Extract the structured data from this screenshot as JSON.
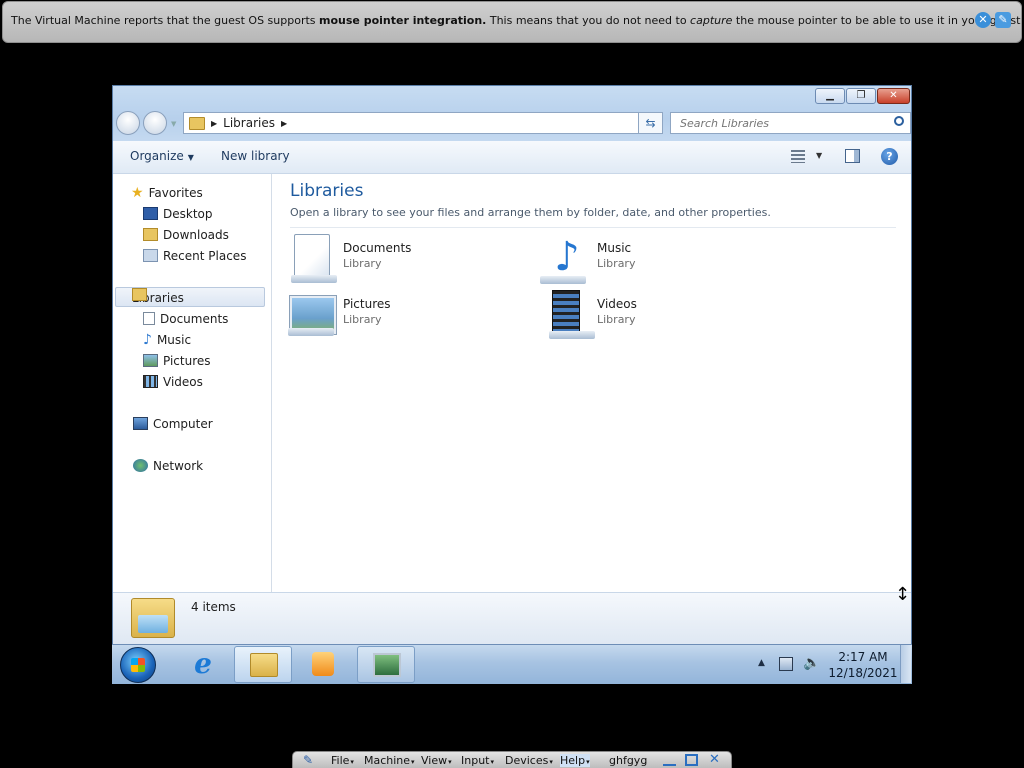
{
  "notification": {
    "text_pre": "The Virtual Machine reports that the guest OS supports ",
    "text_bold": "mouse pointer integration.",
    "text_mid": " This means that you do not need to ",
    "text_italic": "capture",
    "text_post": " the mouse pointer to be able to use it in your guest OS -- all mouse",
    "close_icon": "close-icon",
    "info_icon": "speech-bubble-icon"
  },
  "window": {
    "address": {
      "location": "Libraries"
    },
    "search": {
      "placeholder": "Search Libraries"
    },
    "toolbar": {
      "organize_label": "Organize",
      "new_library_label": "New library"
    },
    "nav": {
      "favorites": "Favorites",
      "desktop": "Desktop",
      "downloads": "Downloads",
      "recent_places": "Recent Places",
      "libraries": "Libraries",
      "documents": "Documents",
      "music": "Music",
      "pictures": "Pictures",
      "videos": "Videos",
      "computer": "Computer",
      "network": "Network"
    },
    "content": {
      "title": "Libraries",
      "subtitle": "Open a library to see your files and arrange them by folder, date, and other properties.",
      "libraries": [
        {
          "name": "Documents",
          "type": "Library",
          "icon": "documents-library-icon"
        },
        {
          "name": "Music",
          "type": "Library",
          "icon": "music-library-icon"
        },
        {
          "name": "Pictures",
          "type": "Library",
          "icon": "pictures-library-icon"
        },
        {
          "name": "Videos",
          "type": "Library",
          "icon": "videos-library-icon"
        }
      ]
    },
    "status": {
      "item_count": "4 items"
    }
  },
  "taskbar": {
    "clock_time": "2:17 AM",
    "clock_date": "12/18/2021"
  },
  "vbox_toolbar": {
    "menus": [
      "File",
      "Machine",
      "View",
      "Input",
      "Devices",
      "Help"
    ],
    "vm_name": "ghfgyg"
  }
}
